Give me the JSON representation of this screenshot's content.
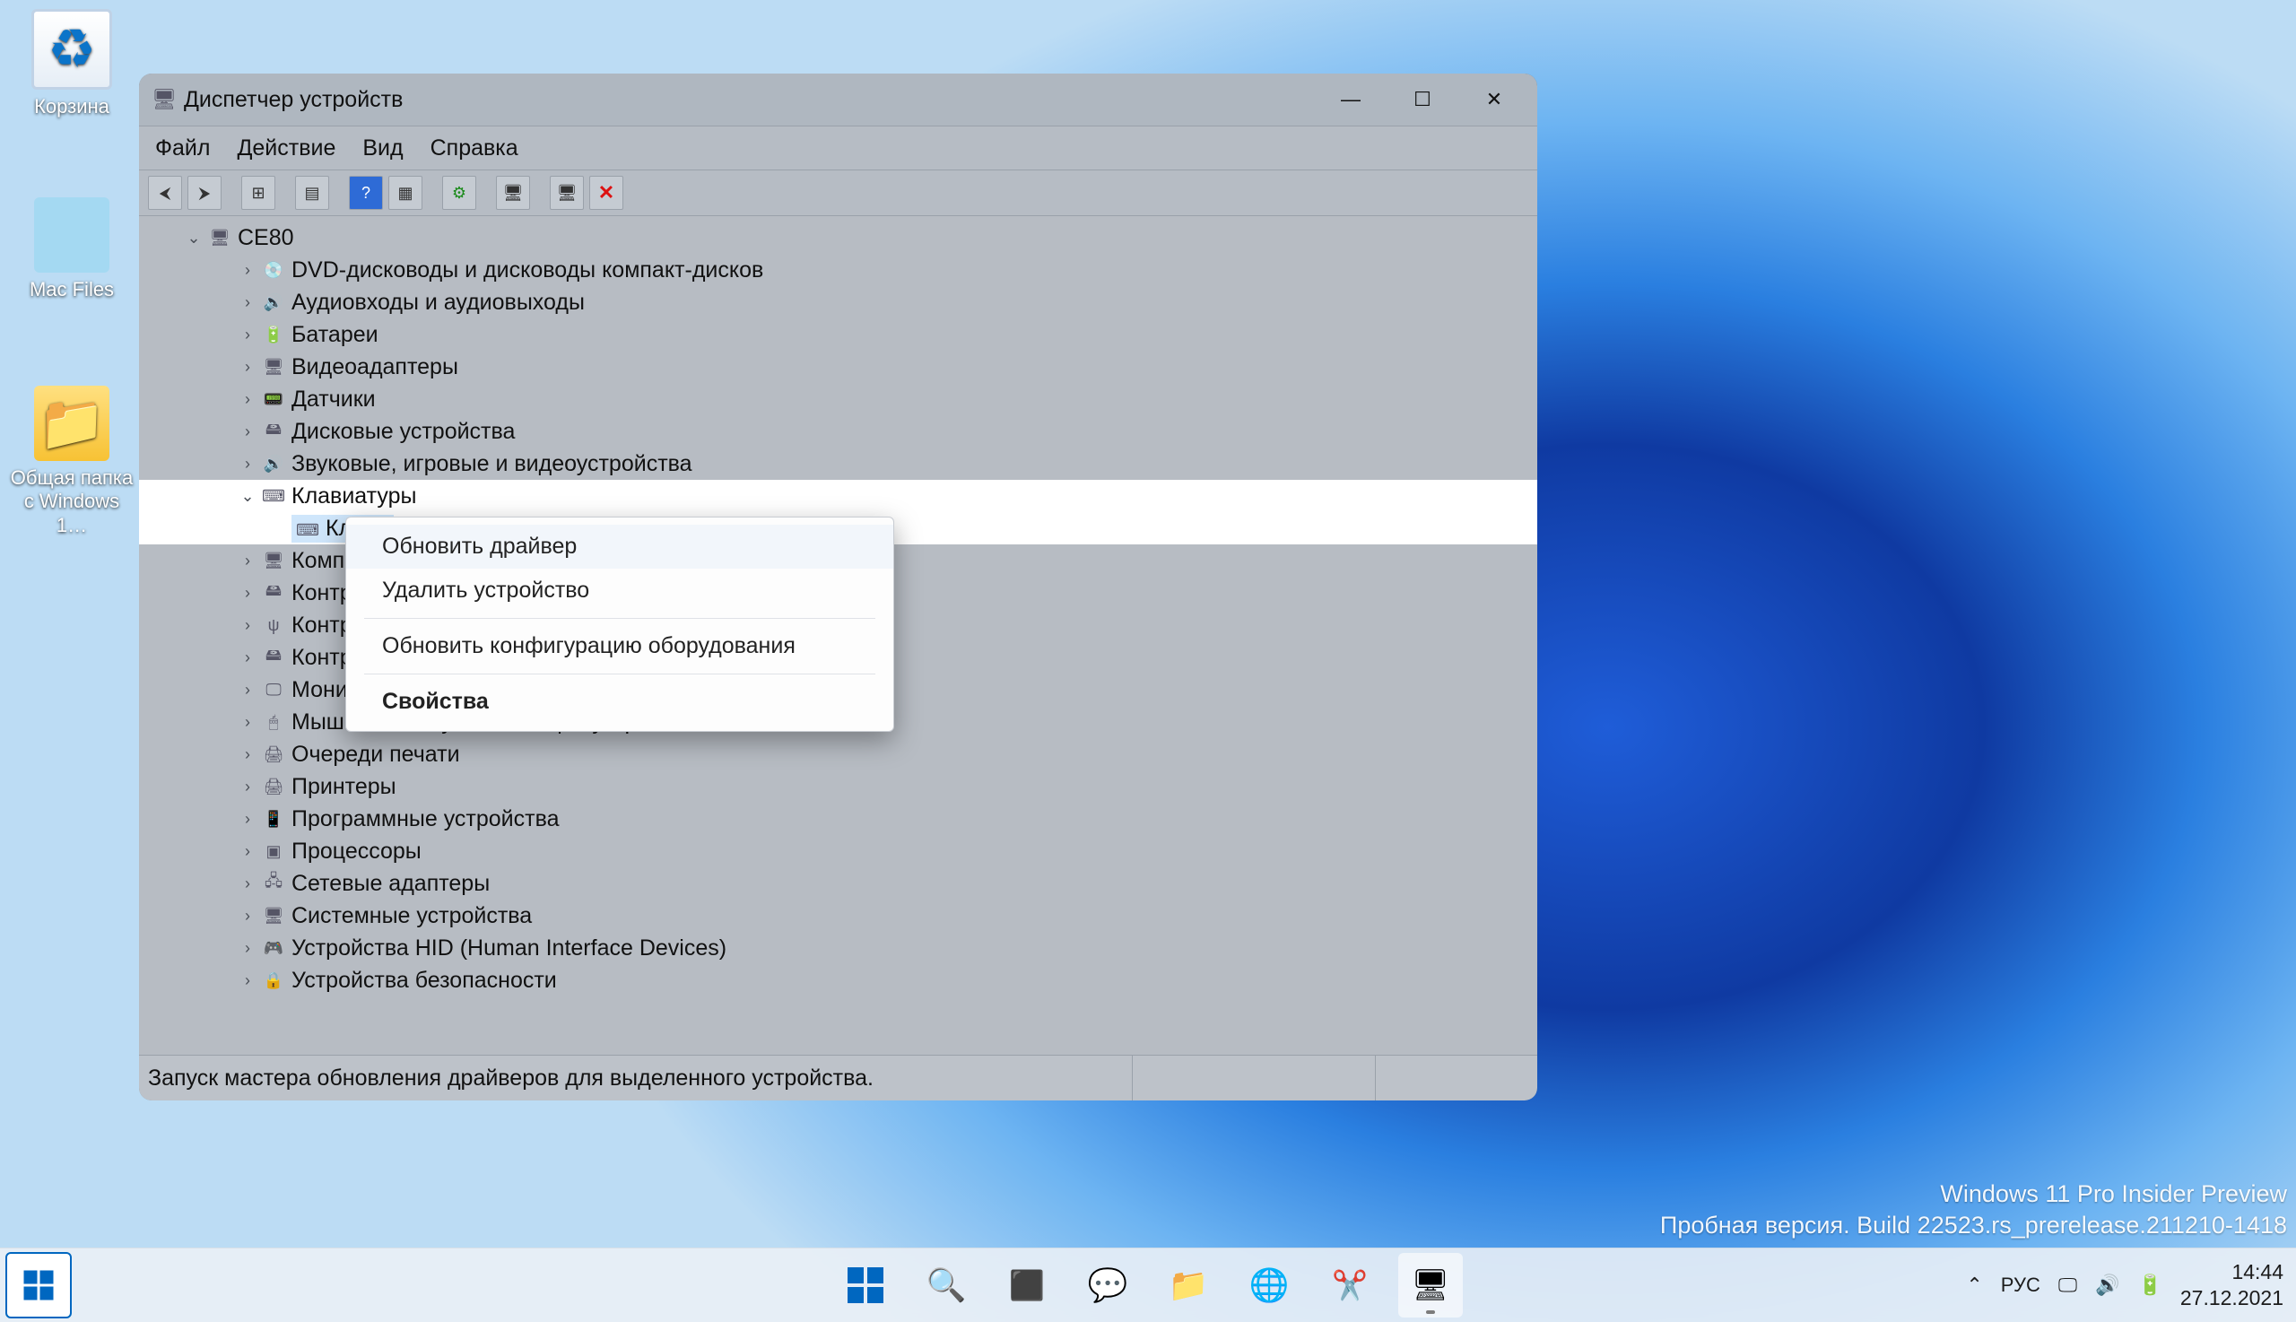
{
  "desktop_icons": {
    "recycle": "Корзина",
    "macfiles": "Mac Files",
    "shared": "Общая папка\nс Windows 1…"
  },
  "window": {
    "title": "Диспетчер устройств",
    "menus": [
      "Файл",
      "Действие",
      "Вид",
      "Справка"
    ],
    "status": "Запуск мастера обновления драйверов для выделенного устройства."
  },
  "tree": {
    "root": "CE80",
    "children": [
      {
        "label": "DVD-дисководы и дисководы компакт-дисков",
        "icon": "💿"
      },
      {
        "label": "Аудиовходы и аудиовыходы",
        "icon": "🔊"
      },
      {
        "label": "Батареи",
        "icon": "🔋"
      },
      {
        "label": "Видеоадаптеры",
        "icon": "🖥"
      },
      {
        "label": "Датчики",
        "icon": "📟"
      },
      {
        "label": "Дисковые устройства",
        "icon": "🖴"
      },
      {
        "label": "Звуковые, игровые и видеоустройства",
        "icon": "🔊"
      },
      {
        "label": "Клавиатуры",
        "icon": "⌨",
        "expanded": true,
        "children": [
          {
            "label": "Клави",
            "icon": "⌨"
          }
        ]
      },
      {
        "label": "Компью",
        "icon": "🖥"
      },
      {
        "label": "Контрол",
        "icon": "🖴"
      },
      {
        "label": "Контрол",
        "icon": "ψ"
      },
      {
        "label": "Контрол",
        "icon": "🖴"
      },
      {
        "label": "Монито",
        "icon": "🖵"
      },
      {
        "label": "Мыши и иные указывающие устройства",
        "icon": "🖱"
      },
      {
        "label": "Очереди печати",
        "icon": "🖨"
      },
      {
        "label": "Принтеры",
        "icon": "🖨"
      },
      {
        "label": "Программные устройства",
        "icon": "📱"
      },
      {
        "label": "Процессоры",
        "icon": "▣"
      },
      {
        "label": "Сетевые адаптеры",
        "icon": "🖧"
      },
      {
        "label": "Системные устройства",
        "icon": "🖥"
      },
      {
        "label": "Устройства HID (Human Interface Devices)",
        "icon": "🎮"
      },
      {
        "label": "Устройства безопасности",
        "icon": "🔒"
      }
    ]
  },
  "context_menu": {
    "update": "Обновить драйвер",
    "remove": "Удалить устройство",
    "scan": "Обновить конфигурацию оборудования",
    "props": "Свойства"
  },
  "watermark": {
    "line1": "Windows 11 Pro Insider Preview",
    "line2": "Пробная версия. Build 22523.rs_prerelease.211210-1418"
  },
  "systray": {
    "lang": "РУС",
    "time": "14:44",
    "date": "27.12.2021"
  }
}
